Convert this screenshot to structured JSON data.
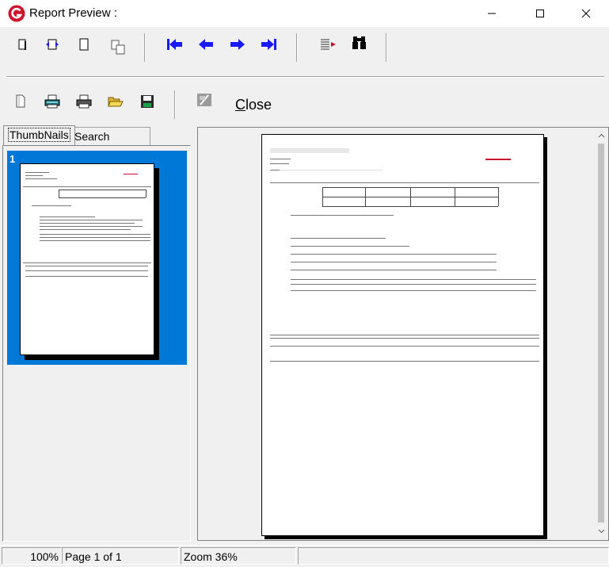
{
  "window": {
    "title": "Report Preview :",
    "app_icon": "genexus-icon"
  },
  "toolbar1": {
    "buttons": [
      "page-width-icon",
      "fit-width-icon",
      "full-page-icon",
      "two-pages-icon",
      "first-page-icon",
      "prev-page-icon",
      "next-page-icon",
      "last-page-icon",
      "goto-page-icon",
      "find-icon"
    ]
  },
  "toolbar2": {
    "buttons": [
      "new-page-icon",
      "print-setup-icon",
      "print-icon",
      "open-icon",
      "save-icon",
      "export-icon"
    ],
    "close_label_first": "C",
    "close_label_rest": "lose"
  },
  "tabs": [
    {
      "label": "ThumbNails",
      "active": true
    },
    {
      "label": "Search Results",
      "active": false
    }
  ],
  "thumbnails": [
    {
      "number": "1",
      "selected": true
    }
  ],
  "status": {
    "zoom_percent": "100%",
    "page_info": "Page 1 of 1",
    "zoom_text": "Zoom 36%"
  },
  "colors": {
    "selection": "#0078d7",
    "arrows": "#1a1aff",
    "brand": "#c8102e"
  }
}
